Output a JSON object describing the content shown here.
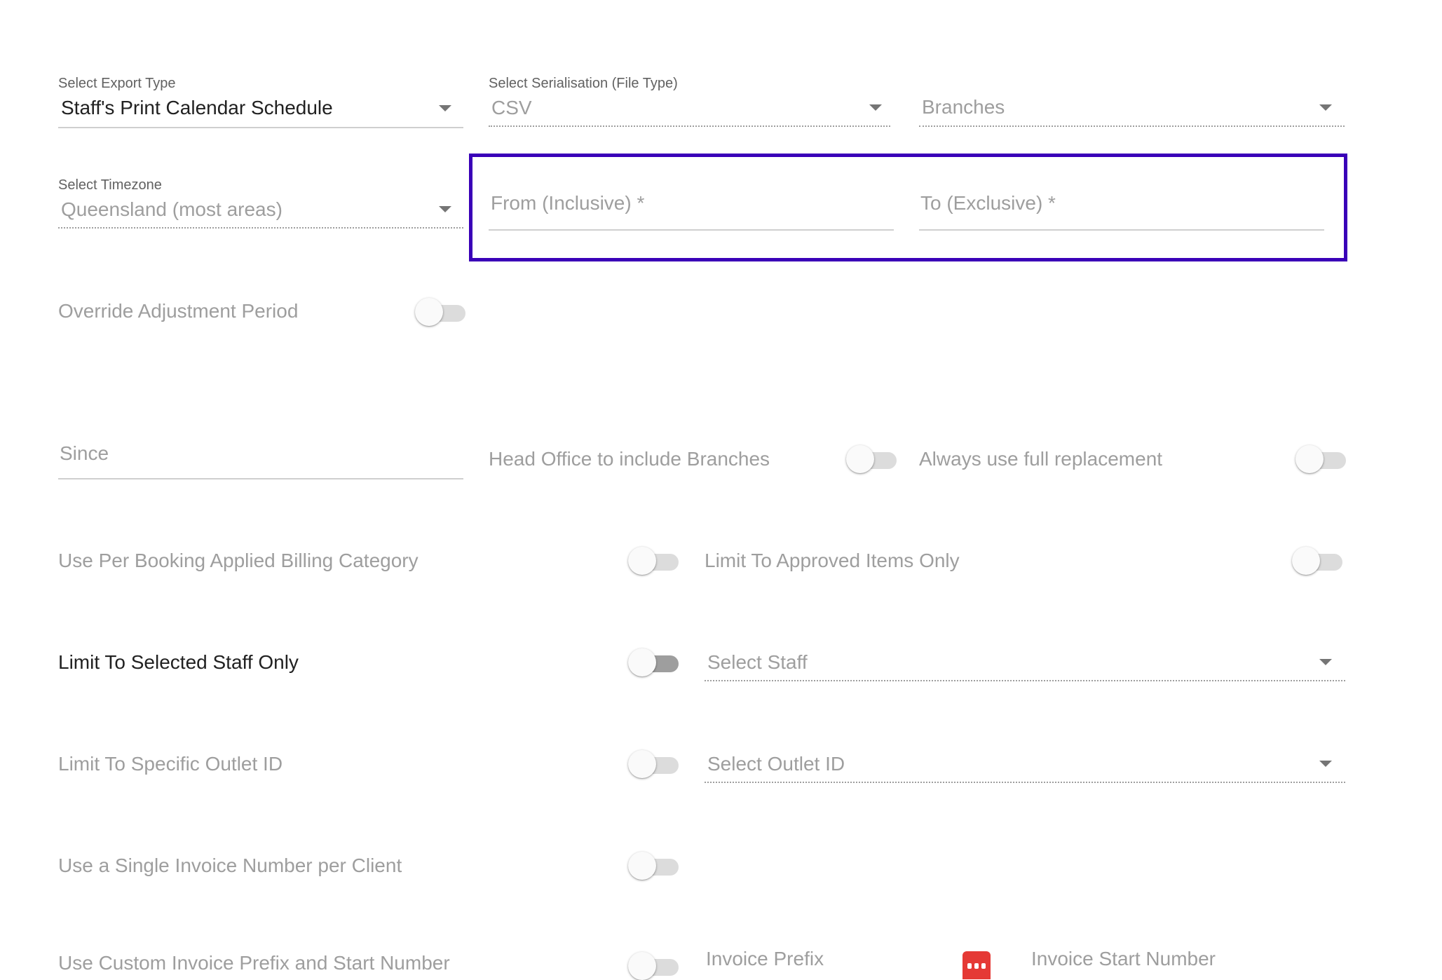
{
  "export_type": {
    "label": "Select Export Type",
    "value": "Staff's Print Calendar Schedule"
  },
  "serialisation": {
    "label": "Select Serialisation (File Type)",
    "value": "CSV"
  },
  "branches": {
    "placeholder": "Branches"
  },
  "timezone": {
    "label": "Select Timezone",
    "value": "Queensland (most areas)"
  },
  "date_range": {
    "from_placeholder": "From (Inclusive) *",
    "to_placeholder": "To (Exclusive) *",
    "highlight_color": "#3a00b8"
  },
  "override_adjustment": {
    "label": "Override Adjustment Period",
    "on": false
  },
  "since": {
    "placeholder": "Since"
  },
  "head_office": {
    "label": "Head Office to include Branches",
    "on": false
  },
  "full_replacement": {
    "label": "Always use full replacement",
    "on": false
  },
  "per_booking_billing": {
    "label": "Use Per Booking Applied Billing Category",
    "on": false
  },
  "approved_items": {
    "label": "Limit To Approved Items Only",
    "on": false
  },
  "selected_staff": {
    "label": "Limit To Selected Staff Only",
    "on": false,
    "select_placeholder": "Select Staff"
  },
  "outlet_id": {
    "label": "Limit To Specific Outlet ID",
    "on": false,
    "select_placeholder": "Select Outlet ID"
  },
  "single_invoice": {
    "label": "Use a Single Invoice Number per Client",
    "on": false
  },
  "custom_invoice": {
    "label": "Use Custom Invoice Prefix and Start Number",
    "on": false,
    "prefix_placeholder": "Invoice Prefix",
    "start_number_placeholder": "Invoice Start Number",
    "icon": "calendar-icon",
    "icon_color": "#e53935"
  }
}
